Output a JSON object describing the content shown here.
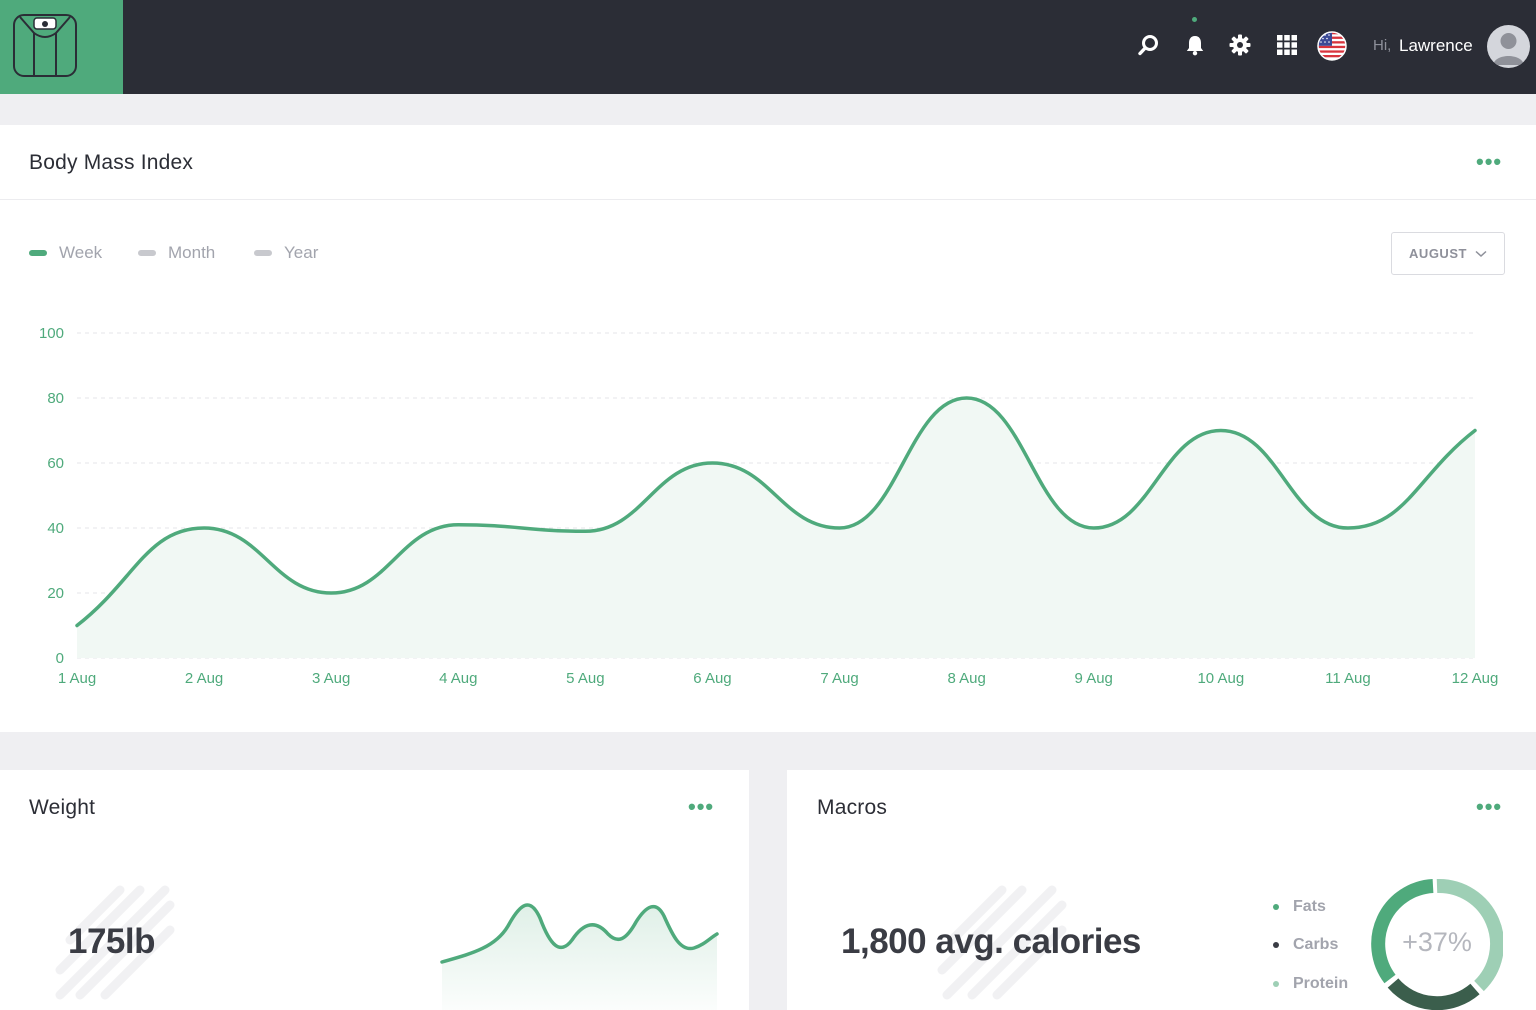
{
  "header": {
    "greeting": "Hi,",
    "username": "Lawrence",
    "icons": [
      "search-icon",
      "bell-icon",
      "gear-icon",
      "apps-grid-icon",
      "us-flag-icon",
      "avatar"
    ]
  },
  "bmi": {
    "title": "Body Mass Index",
    "menu": "•••",
    "legend": [
      {
        "label": "Week",
        "color": "#4faa7c",
        "active": true
      },
      {
        "label": "Month",
        "color": "#c8c9ce",
        "active": false
      },
      {
        "label": "Year",
        "color": "#c8c9ce",
        "active": false
      }
    ],
    "dropdown": {
      "label": "AUGUST"
    }
  },
  "chart_data": {
    "type": "area",
    "x": [
      "1 Aug",
      "2 Aug",
      "3 Aug",
      "4 Aug",
      "5 Aug",
      "6 Aug",
      "7 Aug",
      "8 Aug",
      "9 Aug",
      "10 Aug",
      "11 Aug",
      "12 Aug"
    ],
    "y": [
      10,
      40,
      20,
      41,
      39,
      60,
      40,
      80,
      40,
      70,
      40,
      70
    ],
    "yticks": [
      0,
      20,
      40,
      60,
      80,
      100
    ],
    "ylim": [
      0,
      100
    ],
    "grid": true,
    "color": "#4faa7c"
  },
  "weight": {
    "title": "Weight",
    "menu": "•••",
    "value": "175lb"
  },
  "macros": {
    "title": "Macros",
    "menu": "•••",
    "value": "1,800 avg. calories",
    "items": [
      "Fats",
      "Carbs",
      "Protein"
    ],
    "donut_label": "+37%",
    "donut_colors": [
      "#4faa7c",
      "#9ecfb5",
      "#3b5e4c"
    ]
  }
}
